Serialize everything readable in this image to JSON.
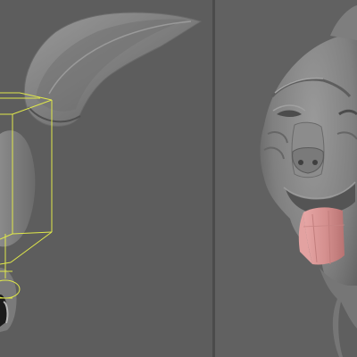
{
  "colors": {
    "viewport_bg_left": "#5d5d5d",
    "viewport_bg_right": "#616161",
    "divider": "#4b4b4b",
    "mesh": "#858585",
    "mesh_dark": "#4a4a4a",
    "tongue": "#d99a99",
    "selection_wireframe": "#e0e84a"
  },
  "viewports": [
    {
      "name": "left-viewport",
      "content": "ear-mesh-with-selection-box"
    },
    {
      "name": "right-viewport",
      "content": "creature-head-with-tongue"
    }
  ]
}
